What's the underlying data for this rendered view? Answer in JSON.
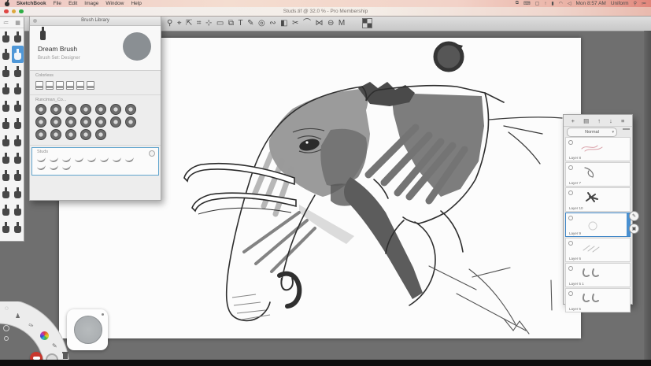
{
  "menu_bar": {
    "menus": [
      "SketchBook",
      "File",
      "Edit",
      "Image",
      "Window",
      "Help"
    ],
    "status_icons": [
      {
        "name": "screen-mirroring-icon",
        "glyph": "⧉"
      },
      {
        "name": "keyboard-icon",
        "glyph": "⌨"
      },
      {
        "name": "display-icon",
        "glyph": "▢"
      },
      {
        "name": "upload-icon",
        "glyph": "↑"
      },
      {
        "name": "battery-icon",
        "glyph": "▮"
      },
      {
        "name": "wifi-icon",
        "glyph": "◠"
      },
      {
        "name": "volume-icon",
        "glyph": "◁"
      }
    ],
    "clock": "Mon 8:57 AM",
    "input_source": "Uniform"
  },
  "window": {
    "title": "Studs.tif @ 32.0 % - Pro Membership"
  },
  "toolbar": {
    "tools": [
      {
        "name": "zoom-tool-icon",
        "glyph": "⚲"
      },
      {
        "name": "select-tool-icon",
        "glyph": "⌖"
      },
      {
        "name": "move-tool-icon",
        "glyph": "⇱"
      },
      {
        "name": "crop-tool-icon",
        "glyph": "⌗"
      },
      {
        "name": "transform-tool-icon",
        "glyph": "⊹"
      },
      {
        "name": "rect-select-tool-icon",
        "glyph": "▭"
      },
      {
        "name": "layer-tool-icon",
        "glyph": "⧉"
      },
      {
        "name": "text-tool-icon",
        "glyph": "T"
      },
      {
        "name": "pencil-tool-icon",
        "glyph": "✎"
      },
      {
        "name": "eraser-tool-icon",
        "glyph": "◎"
      },
      {
        "name": "smudge-tool-icon",
        "glyph": "∾"
      },
      {
        "name": "fill-tool-icon",
        "glyph": "◧"
      },
      {
        "name": "cut-tool-icon",
        "glyph": "✂"
      },
      {
        "name": "stroke-tool-icon",
        "glyph": "⌒"
      },
      {
        "name": "symmetry-tool-icon",
        "glyph": "⋈"
      },
      {
        "name": "shape-tool-icon",
        "glyph": "⊖"
      },
      {
        "name": "brushes-tool-icon",
        "glyph": "M"
      },
      {
        "name": "color-wheel-icon",
        "glyph": ""
      },
      {
        "name": "gradient-swatch-icon",
        "glyph": ""
      }
    ]
  },
  "brush_palette": {
    "rows": 12,
    "cols": 2,
    "selected_index": 3,
    "header_icons": [
      {
        "name": "palette-menu-icon",
        "glyph": "≔"
      },
      {
        "name": "palette-grid-icon",
        "glyph": "▦"
      }
    ]
  },
  "brush_library": {
    "title": "Brush Library",
    "brush_name": "Dream Brush",
    "brush_set": "Brush Set: Designer",
    "sections": [
      {
        "label": "Colorless",
        "type": "bottle",
        "rows": [
          6
        ],
        "selected": false
      },
      {
        "label": "Runciman_Co...",
        "type": "disc",
        "rows": [
          7,
          7,
          5
        ],
        "selected": false
      },
      {
        "label": "Studs",
        "type": "stroke",
        "rows": [
          8,
          3
        ],
        "selected": true
      }
    ]
  },
  "layers_panel": {
    "tools": [
      {
        "name": "add-layer-icon",
        "glyph": "+"
      },
      {
        "name": "folder-icon",
        "glyph": "▤"
      },
      {
        "name": "import-layer-icon",
        "glyph": "↑"
      },
      {
        "name": "merge-layer-icon",
        "glyph": "↓"
      },
      {
        "name": "layers-menu-icon",
        "glyph": "≡"
      }
    ],
    "blend_mode": "Normal",
    "layers": [
      {
        "name": "Layer 8",
        "selected": false,
        "thumb": "pink-scribble"
      },
      {
        "name": "Layer 7",
        "selected": false,
        "thumb": "trunk-sketch"
      },
      {
        "name": "Layer 10",
        "selected": false,
        "thumb": "dark-figure"
      },
      {
        "name": "Layer 9",
        "selected": true,
        "thumb": "faint-circle"
      },
      {
        "name": "Layer 6",
        "selected": false,
        "thumb": "faint-lines"
      },
      {
        "name": "Layer 5 1",
        "selected": false,
        "thumb": "tusks"
      },
      {
        "name": "Layer 5",
        "selected": false,
        "thumb": "tusks"
      }
    ],
    "side_buttons": [
      {
        "name": "edit-layer-icon",
        "glyph": "✎"
      },
      {
        "name": "lock-layer-icon",
        "glyph": "▣"
      }
    ]
  },
  "lagoon": {
    "items": [
      {
        "name": "lasso-icon",
        "glyph": "◌"
      },
      {
        "name": "people-icon",
        "glyph": "♟"
      },
      {
        "name": "airbrush-icon",
        "glyph": "✑"
      },
      {
        "name": "color-wheel-icon",
        "glyph": ""
      },
      {
        "name": "pencil-icon",
        "glyph": "✎"
      },
      {
        "name": "trash-icon",
        "glyph": ""
      }
    ]
  },
  "colors": {
    "accent_blue": "#3f86c6",
    "workspace_gray": "#6f6f6f",
    "canvas_white": "#fcfcfc",
    "menubar_pink": "#f0cfc9",
    "badge_red": "#c8372d"
  }
}
